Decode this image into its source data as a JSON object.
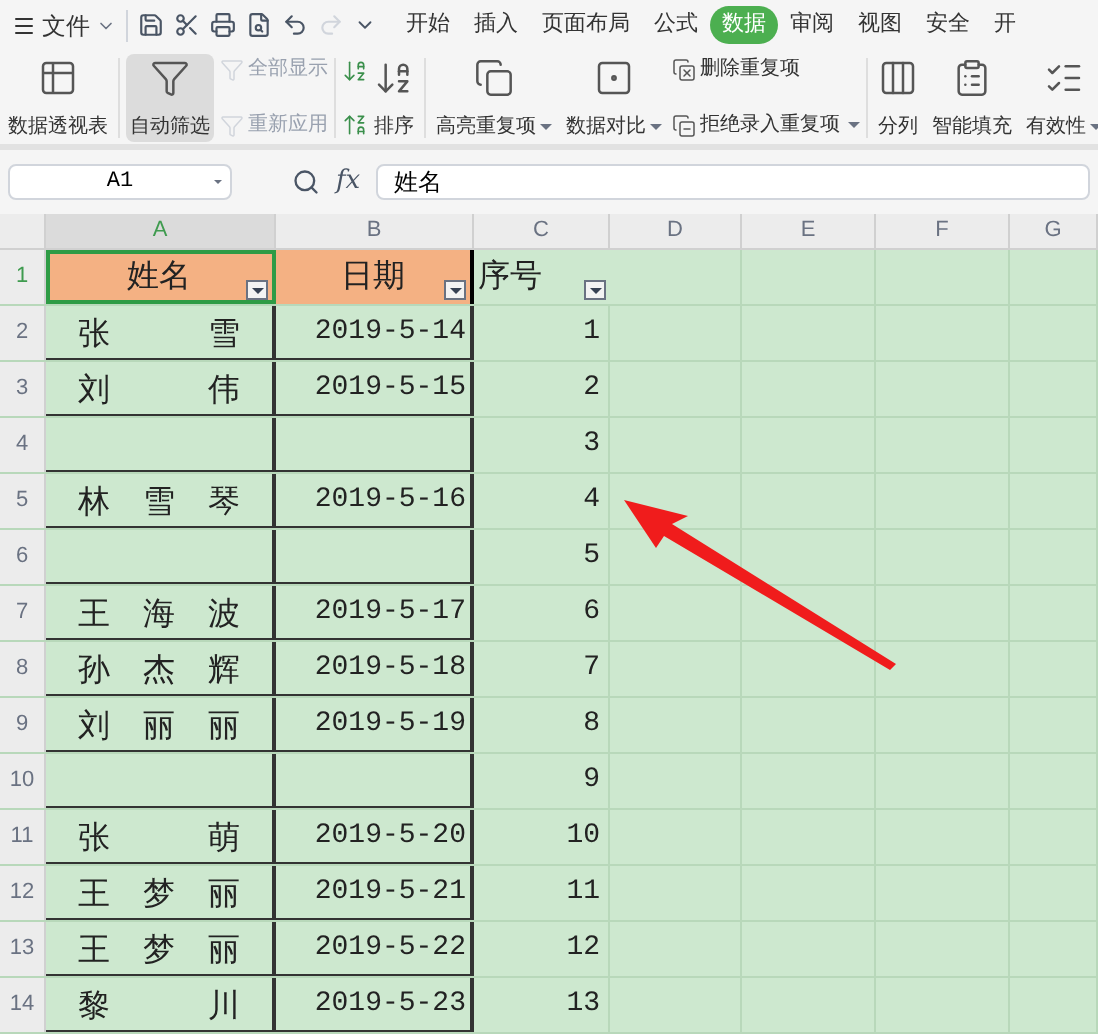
{
  "menu": {
    "label": "文件"
  },
  "tabs": [
    {
      "label": "开始",
      "selected": false
    },
    {
      "label": "插入",
      "selected": false
    },
    {
      "label": "页面布局",
      "selected": false
    },
    {
      "label": "公式",
      "selected": false
    },
    {
      "label": "数据",
      "selected": true
    },
    {
      "label": "审阅",
      "selected": false
    },
    {
      "label": "视图",
      "selected": false
    },
    {
      "label": "安全",
      "selected": false
    },
    {
      "label": "开",
      "selected": false
    }
  ],
  "ribbon": [
    {
      "kind": "large",
      "label": "数据透视表",
      "active": false,
      "disabled": false,
      "dropdown": false
    },
    {
      "kind": "large",
      "label": "自动筛选",
      "active": true,
      "disabled": false,
      "dropdown": false
    },
    {
      "kind": "stack",
      "items": [
        {
          "label": "全部显示",
          "disabled": true,
          "dropdown": false
        },
        {
          "label": "重新应用",
          "disabled": true,
          "dropdown": false
        }
      ]
    },
    {
      "kind": "sortpair",
      "label": "排序"
    },
    {
      "kind": "large",
      "label": "高亮重复项",
      "active": false,
      "disabled": false,
      "dropdown": true
    },
    {
      "kind": "large",
      "label": "数据对比",
      "active": false,
      "disabled": false,
      "dropdown": true
    },
    {
      "kind": "stack",
      "items": [
        {
          "label": "删除重复项",
          "disabled": false,
          "dropdown": false
        },
        {
          "label": "拒绝录入重复项",
          "disabled": false,
          "dropdown": true
        }
      ]
    },
    {
      "kind": "large",
      "label": "分列",
      "active": false,
      "disabled": false,
      "dropdown": false
    },
    {
      "kind": "large",
      "label": "智能填充",
      "active": false,
      "disabled": false,
      "dropdown": false
    },
    {
      "kind": "large",
      "label": "有效性",
      "active": false,
      "disabled": false,
      "dropdown": true
    }
  ],
  "formula_bar": {
    "cell_ref": "A1",
    "fx": "fx",
    "value": "姓名"
  },
  "columns": [
    {
      "label": "A",
      "selected": true
    },
    {
      "label": "B",
      "selected": false
    },
    {
      "label": "C",
      "selected": false
    },
    {
      "label": "D",
      "selected": false
    },
    {
      "label": "E",
      "selected": false
    },
    {
      "label": "F",
      "selected": false
    },
    {
      "label": "G",
      "selected": false
    }
  ],
  "header_row": {
    "number": "1",
    "cells": [
      {
        "text": "姓名",
        "filter": true,
        "highlight": true,
        "selected": true
      },
      {
        "text": "日期",
        "filter": true,
        "highlight": true,
        "selected": false
      },
      {
        "text": "序号",
        "filter": true,
        "highlight": false,
        "selected": false
      }
    ]
  },
  "rows": [
    {
      "number": "2",
      "name": "张雪",
      "date": "2019-5-14",
      "seq": "1"
    },
    {
      "number": "3",
      "name": "刘伟",
      "date": "2019-5-15",
      "seq": "2"
    },
    {
      "number": "4",
      "seq": "3"
    },
    {
      "number": "5",
      "name": "林雪琴",
      "date": "2019-5-16",
      "seq": "4"
    },
    {
      "number": "6",
      "seq": "5"
    },
    {
      "number": "7",
      "name": "王海波",
      "date": "2019-5-17",
      "seq": "6"
    },
    {
      "number": "8",
      "name": "孙杰辉",
      "date": "2019-5-18",
      "seq": "7"
    },
    {
      "number": "9",
      "name": "刘丽丽",
      "date": "2019-5-19",
      "seq": "8"
    },
    {
      "number": "10",
      "seq": "9"
    },
    {
      "number": "11",
      "name": "张萌",
      "date": "2019-5-20",
      "seq": "10"
    },
    {
      "number": "12",
      "name": "王梦丽",
      "date": "2019-5-21",
      "seq": "11"
    },
    {
      "number": "13",
      "name": "王梦丽",
      "date": "2019-5-22",
      "seq": "12"
    },
    {
      "number": "14",
      "name": "黎川",
      "date": "2019-5-23",
      "seq": "13"
    }
  ]
}
